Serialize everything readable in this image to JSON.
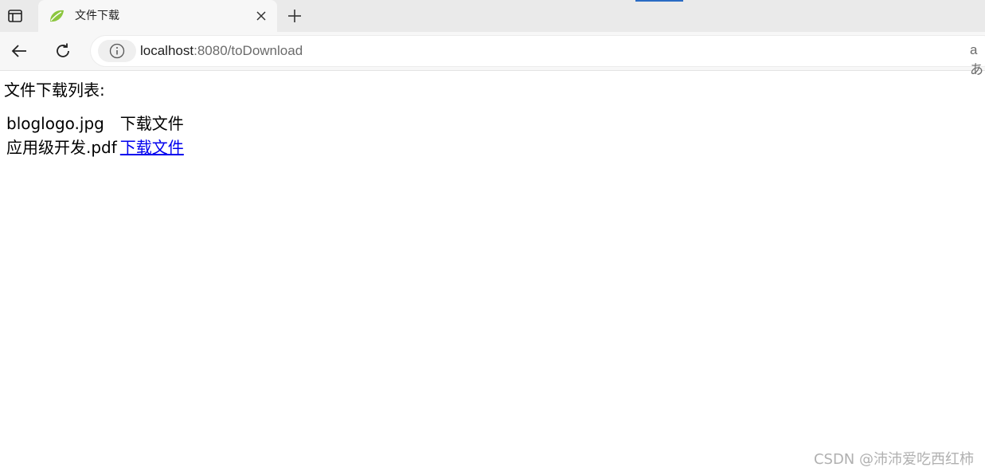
{
  "browser": {
    "tab": {
      "title": "文件下载",
      "favicon": "spring-leaf-icon"
    },
    "address": {
      "host": "localhost",
      "rest": ":8080/toDownload"
    },
    "reader_label": "aあ"
  },
  "page": {
    "heading": "文件下载列表:",
    "files": [
      {
        "name": "bloglogo.jpg",
        "action": "下载文件",
        "is_link": false
      },
      {
        "name": "应用级开发.pdf",
        "action": "下载文件",
        "is_link": true
      }
    ]
  },
  "watermark": "CSDN @沛沛爱吃西红柿",
  "colors": {
    "link": "#0000ee",
    "favicon": "#7dba2f"
  }
}
